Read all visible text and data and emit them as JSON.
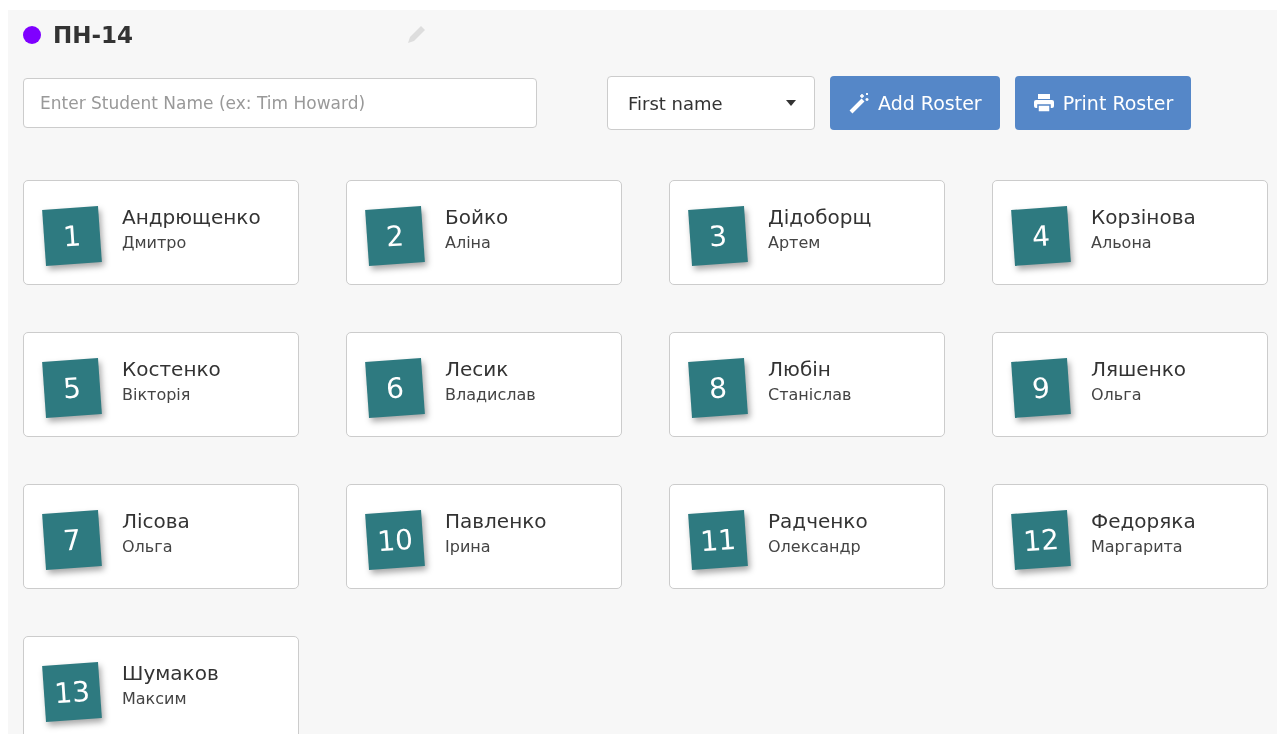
{
  "header": {
    "title": "ПН-14",
    "color": "#7f00ff"
  },
  "search": {
    "placeholder": "Enter Student Name (ex: Tim Howard)"
  },
  "sort": {
    "value": "First name"
  },
  "buttons": [
    {
      "kind": "add",
      "label": "Add Roster"
    },
    {
      "kind": "print",
      "label": "Print Roster"
    }
  ],
  "students": [
    {
      "number": "1",
      "last_name": "Андрющенко",
      "first_name": "Дмитро"
    },
    {
      "number": "2",
      "last_name": "Бойко",
      "first_name": "Аліна"
    },
    {
      "number": "3",
      "last_name": "Дідоборщ",
      "first_name": "Артем"
    },
    {
      "number": "4",
      "last_name": "Корзінова",
      "first_name": "Альона"
    },
    {
      "number": "5",
      "last_name": "Костенко",
      "first_name": "Вікторія"
    },
    {
      "number": "6",
      "last_name": "Лесик",
      "first_name": "Владислав"
    },
    {
      "number": "8",
      "last_name": "Любін",
      "first_name": "Станіслав"
    },
    {
      "number": "9",
      "last_name": "Ляшенко",
      "first_name": "Ольга"
    },
    {
      "number": "7",
      "last_name": "Лісова",
      "first_name": "Ольга"
    },
    {
      "number": "10",
      "last_name": "Павленко",
      "first_name": "Ірина"
    },
    {
      "number": "11",
      "last_name": "Радченко",
      "first_name": "Олександр"
    },
    {
      "number": "12",
      "last_name": "Федоряка",
      "first_name": "Маргарита"
    },
    {
      "number": "13",
      "last_name": "Шумаков",
      "first_name": "Максим"
    }
  ]
}
